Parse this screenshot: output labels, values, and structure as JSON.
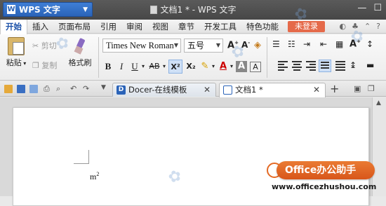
{
  "titlebar": {
    "app_name": "WPS 文字",
    "doc_title": "文档1 * - WPS 文字"
  },
  "menu": {
    "items": [
      "开始",
      "插入",
      "页面布局",
      "引用",
      "审阅",
      "视图",
      "章节",
      "开发工具",
      "特色功能"
    ],
    "login": "未登录"
  },
  "ribbon": {
    "cut": "剪切",
    "copy": "复制",
    "paste": "粘贴",
    "format_painter": "格式刷",
    "font_name": "Times New Roman",
    "font_size": "五号",
    "bold": "B",
    "italic": "I",
    "underline": "U",
    "strike": "AB",
    "superscript": "X²",
    "subscript": "X₂"
  },
  "tabs": [
    {
      "label": "Docer-在线模板"
    },
    {
      "label": "文档1 *"
    }
  ],
  "document": {
    "text_base": "m",
    "text_sup": "2"
  },
  "watermark": {
    "badge": "Office办公助手",
    "url": "www.officezhushou.com"
  },
  "colors": {
    "title_bg": "#474747",
    "accent_blue": "#2a63b8",
    "login_orange": "#e56a4a",
    "badge_orange": "#d8561a"
  }
}
